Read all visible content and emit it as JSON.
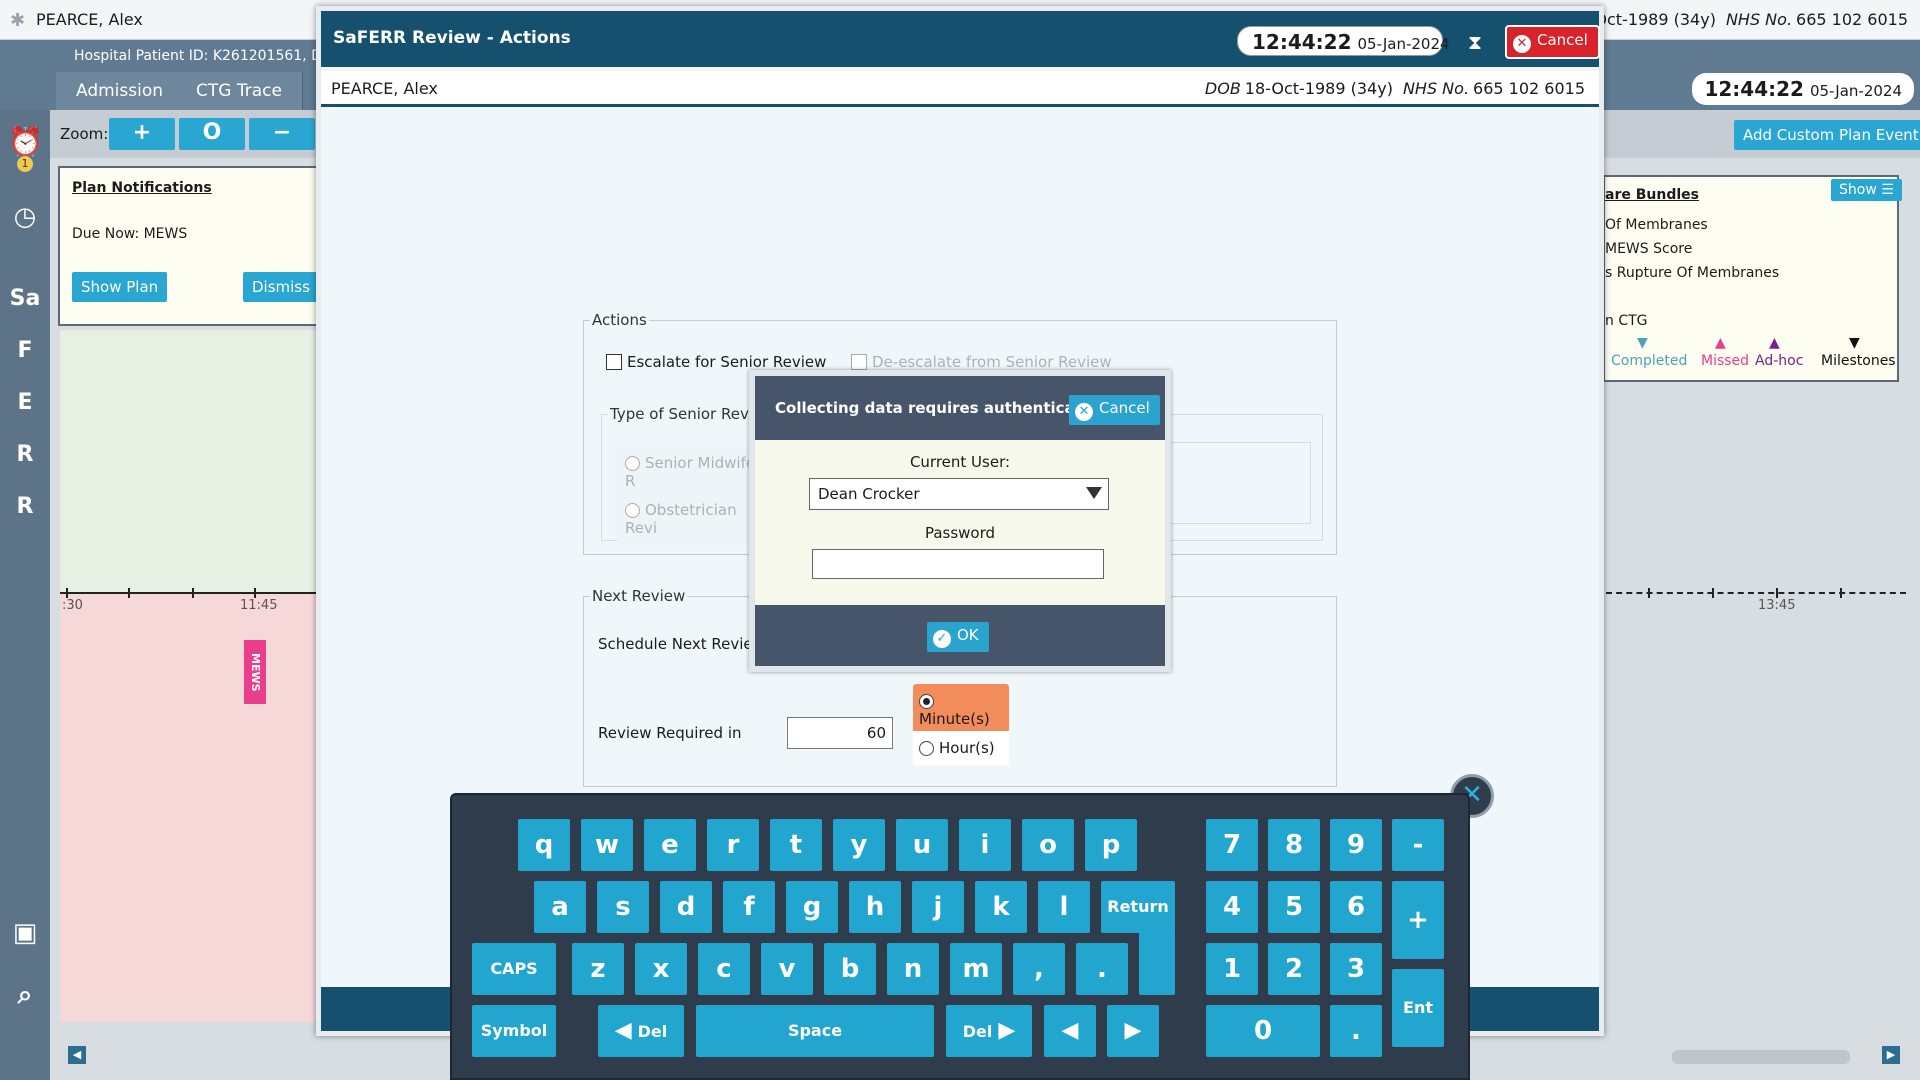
{
  "app": {
    "patient_name": "PEARCE, Alex",
    "dob_label": "DOB",
    "dob": "18-Oct-1989 (34y)",
    "nhs_label": "NHS No.",
    "nhs": "665 102 6015",
    "hospital_id": "Hospital Patient ID: K261201561, De",
    "tabs": [
      "Admission",
      "CTG Trace"
    ],
    "clock_time": "12:44:22",
    "clock_date": "05-Jan-2024",
    "zoom_label": "Zoom:",
    "zoom_in": "+",
    "zoom_reset": "O",
    "zoom_out": "−",
    "rail_badge": "1",
    "rail_letters": [
      "Sa",
      "F",
      "E",
      "R",
      "R"
    ],
    "add_custom_plan_event": "Add Custom Plan Event"
  },
  "plan_notifications": {
    "title": "Plan Notifications",
    "due_now": "Due Now: MEWS",
    "show_plan": "Show Plan",
    "dismiss": "Dismiss"
  },
  "timeline": {
    "left_label_start": ":30",
    "left_label_mid": "11:45",
    "right_label": "13:45",
    "marker": "MEWS"
  },
  "care_bundles": {
    "title": "are Bundles",
    "show": "Show",
    "items": [
      "Of Membranes",
      "MEWS Score",
      "s Rupture Of Membranes",
      "",
      "n CTG"
    ],
    "legend": [
      {
        "label": "Completed",
        "color": "#4fa3b5"
      },
      {
        "label": "Missed",
        "color": "#e83e8c"
      },
      {
        "label": "Ad-hoc",
        "color": "#7b1f8a"
      },
      {
        "label": "Milestones",
        "color": "#111111"
      }
    ]
  },
  "modal": {
    "title": "SaFERR Review - Actions",
    "clock_time": "12:44:22",
    "clock_date": "05-Jan-2024",
    "cancel": "Cancel",
    "actions_legend": "Actions",
    "escalate": "Escalate for Senior Review",
    "deescalate": "De-escalate from Senior Review",
    "type_legend": "Type of Senior Review",
    "opt_senior_midwife": "Senior Midwife R",
    "opt_obstetrician": "Obstetrician Revi",
    "next_review_legend": "Next Review",
    "schedule_next": "Schedule Next Review",
    "review_required_in": "Review Required in",
    "review_value": "60",
    "unit_minutes": "Minute(s)",
    "unit_hours": "Hour(s)"
  },
  "auth": {
    "message": "Collecting data requires authentication.",
    "cancel": "Cancel",
    "current_user_label": "Current User:",
    "current_user": "Dean Crocker",
    "password_label": "Password",
    "ok": "OK"
  },
  "keyboard": {
    "row1": [
      "q",
      "w",
      "e",
      "r",
      "t",
      "y",
      "u",
      "i",
      "o",
      "p"
    ],
    "row2": [
      "a",
      "s",
      "d",
      "f",
      "g",
      "h",
      "j",
      "k",
      "l"
    ],
    "row3": [
      "z",
      "x",
      "c",
      "v",
      "b",
      "n",
      "m",
      ",",
      "."
    ],
    "return": "Return",
    "caps": "CAPS",
    "symbol": "Symbol",
    "del_left": "Del",
    "space": "Space",
    "del_right": "Del",
    "arrow_left": "◀",
    "arrow_right": "▶",
    "num_row1": [
      "7",
      "8",
      "9",
      "-"
    ],
    "num_row2": [
      "4",
      "5",
      "6"
    ],
    "num_row3": [
      "1",
      "2",
      "3"
    ],
    "plus": "+",
    "zero": "0",
    "dot": ".",
    "enter": "Ent",
    "close": "✕"
  }
}
